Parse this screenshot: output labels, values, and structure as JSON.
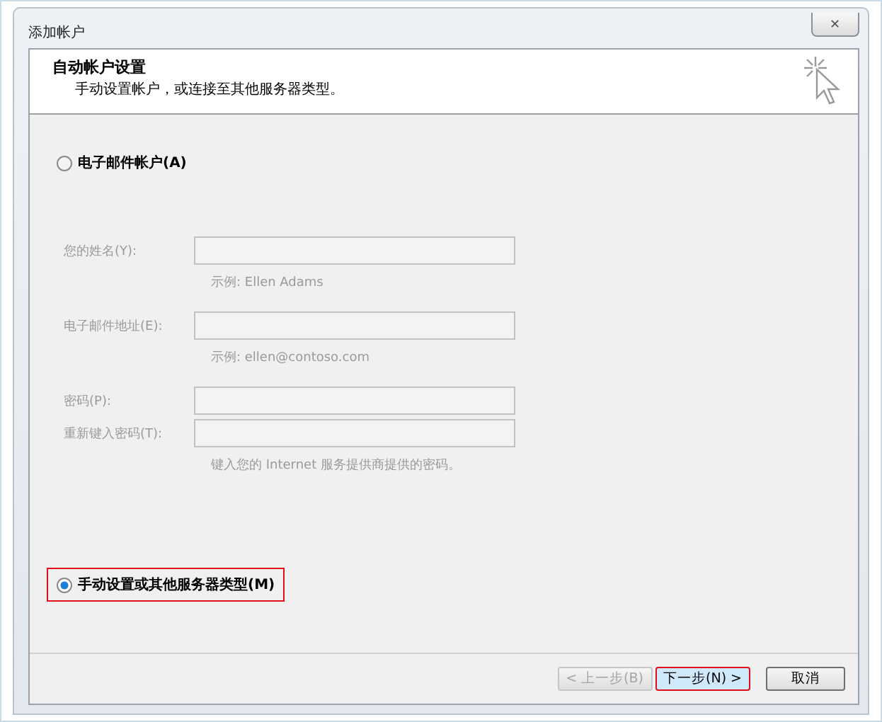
{
  "window": {
    "title": "添加帐户",
    "close": "✕"
  },
  "header": {
    "title": "自动帐户设置",
    "subtitle": "手动设置帐户，或连接至其他服务器类型。"
  },
  "options": [
    {
      "label": "电子邮件帐户(A)",
      "selected": false,
      "highlighted": false
    },
    {
      "label": "手动设置或其他服务器类型(M)",
      "selected": true,
      "highlighted": true
    }
  ],
  "fields": [
    {
      "label": "您的姓名(Y):",
      "hint": "示例: Ellen Adams",
      "disabled": true
    },
    {
      "label": "电子邮件地址(E):",
      "hint": "示例: ellen@contoso.com",
      "disabled": true
    },
    {
      "label": "密码(P):",
      "disabled": true
    },
    {
      "label": "重新键入密码(T):",
      "hint": "键入您的 Internet 服务提供商提供的密码。",
      "disabled": true
    }
  ],
  "buttons": [
    {
      "label": "< 上一步(B)",
      "disabled": true,
      "highlighted": false
    },
    {
      "label": "下一步(N) >",
      "disabled": false,
      "highlighted": true
    },
    {
      "label": "取消",
      "disabled": false,
      "highlighted": false
    }
  ]
}
